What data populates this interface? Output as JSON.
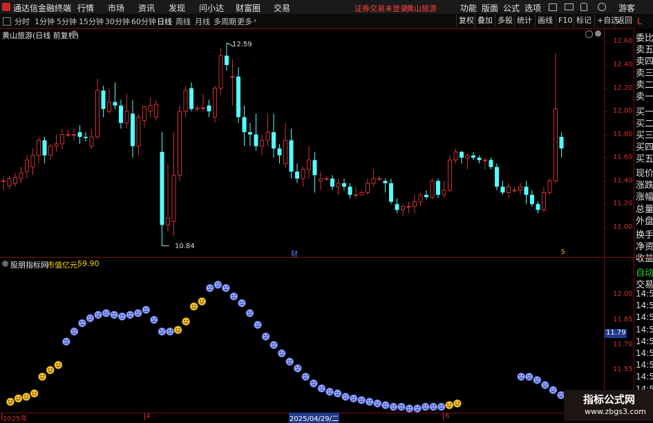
{
  "titlebar": {
    "app_name": "通达信金融终端",
    "menus": [
      "行情",
      "市场",
      "资讯",
      "发现",
      "问小达",
      "财富圈",
      "交易"
    ],
    "login_status": "证券交易未登录",
    "stock_name": "黄山旅游",
    "right_menus": [
      "功能",
      "版面",
      "公式",
      "选项"
    ],
    "user": "游客"
  },
  "toolbar": {
    "periods": [
      "分时",
      "1分钟",
      "5分钟",
      "15分钟",
      "30分钟",
      "60分钟",
      "日线",
      "周线",
      "月线",
      "多周期",
      "更多"
    ],
    "active_period": "日线",
    "right_buttons": [
      "复权",
      "叠加",
      "多股",
      "统计",
      "画线",
      "F10",
      "标记",
      "+自选",
      "返回"
    ]
  },
  "main_chart": {
    "title": "黄山旅游(日线 前复权)",
    "price_ticks": [
      "12.60",
      "12.40",
      "12.20",
      "12.00",
      "11.80",
      "11.60",
      "11.40",
      "11.20",
      "11.00"
    ],
    "high_label": "12.59",
    "low_label": "10.84",
    "marker_cai": "财",
    "marker_s": "S",
    "up_color": "#d23232",
    "down_color": "#54ffff"
  },
  "chart_data": {
    "type": "candlestick",
    "ylim": [
      10.82,
      12.68
    ],
    "candles": [
      {
        "o": 11.4,
        "h": 11.44,
        "l": 11.32,
        "c": 11.4
      },
      {
        "o": 11.36,
        "h": 11.44,
        "l": 11.33,
        "c": 11.42
      },
      {
        "o": 11.38,
        "h": 11.47,
        "l": 11.35,
        "c": 11.43
      },
      {
        "o": 11.42,
        "h": 11.52,
        "l": 11.38,
        "c": 11.47
      },
      {
        "o": 11.48,
        "h": 11.62,
        "l": 11.42,
        "c": 11.58
      },
      {
        "o": 11.52,
        "h": 11.68,
        "l": 11.45,
        "c": 11.62
      },
      {
        "o": 11.62,
        "h": 11.78,
        "l": 11.55,
        "c": 11.75
      },
      {
        "o": 11.75,
        "h": 11.78,
        "l": 11.55,
        "c": 11.62
      },
      {
        "o": 11.62,
        "h": 11.72,
        "l": 11.58,
        "c": 11.7
      },
      {
        "o": 11.7,
        "h": 11.8,
        "l": 11.65,
        "c": 11.72
      },
      {
        "o": 11.72,
        "h": 11.85,
        "l": 11.67,
        "c": 11.8
      },
      {
        "o": 11.8,
        "h": 11.84,
        "l": 11.78,
        "c": 11.8
      },
      {
        "o": 11.8,
        "h": 11.85,
        "l": 11.75,
        "c": 11.8
      },
      {
        "o": 11.82,
        "h": 11.88,
        "l": 11.72,
        "c": 11.78
      },
      {
        "o": 11.78,
        "h": 11.82,
        "l": 11.74,
        "c": 11.77
      },
      {
        "o": 11.7,
        "h": 11.85,
        "l": 11.68,
        "c": 11.78
      },
      {
        "o": 11.78,
        "h": 12.28,
        "l": 11.76,
        "c": 12.18
      },
      {
        "o": 12.18,
        "h": 12.22,
        "l": 11.95,
        "c": 12.02
      },
      {
        "o": 12.0,
        "h": 12.2,
        "l": 11.98,
        "c": 12.08
      },
      {
        "o": 12.08,
        "h": 12.25,
        "l": 12.02,
        "c": 12.05
      },
      {
        "o": 12.05,
        "h": 12.1,
        "l": 11.85,
        "c": 11.9
      },
      {
        "o": 11.9,
        "h": 12.15,
        "l": 11.85,
        "c": 12.0
      },
      {
        "o": 11.98,
        "h": 12.1,
        "l": 11.6,
        "c": 11.7
      },
      {
        "o": 11.7,
        "h": 11.98,
        "l": 11.62,
        "c": 11.95
      },
      {
        "o": 11.92,
        "h": 12.05,
        "l": 11.86,
        "c": 12.04
      },
      {
        "o": 12.0,
        "h": 12.12,
        "l": 11.95,
        "c": 12.05
      },
      {
        "o": 11.95,
        "h": 12.1,
        "l": 11.92,
        "c": 12.06
      },
      {
        "o": 11.65,
        "h": 11.82,
        "l": 10.84,
        "c": 11.02
      },
      {
        "o": 11.02,
        "h": 11.55,
        "l": 10.96,
        "c": 11.08
      },
      {
        "o": 11.05,
        "h": 11.82,
        "l": 10.92,
        "c": 11.45
      },
      {
        "o": 11.45,
        "h": 12.05,
        "l": 11.4,
        "c": 12.0
      },
      {
        "o": 12.0,
        "h": 12.22,
        "l": 11.95,
        "c": 12.18
      },
      {
        "o": 12.2,
        "h": 12.25,
        "l": 12.0,
        "c": 12.02
      },
      {
        "o": 12.02,
        "h": 12.05,
        "l": 12.0,
        "c": 12.03
      },
      {
        "o": 12.03,
        "h": 12.15,
        "l": 12.0,
        "c": 12.03
      },
      {
        "o": 12.05,
        "h": 12.1,
        "l": 11.95,
        "c": 12.0
      },
      {
        "o": 11.95,
        "h": 12.22,
        "l": 11.9,
        "c": 12.2
      },
      {
        "o": 12.2,
        "h": 12.55,
        "l": 12.15,
        "c": 12.48
      },
      {
        "o": 12.48,
        "h": 12.59,
        "l": 12.35,
        "c": 12.4
      },
      {
        "o": 12.3,
        "h": 12.45,
        "l": 12.05,
        "c": 12.3
      },
      {
        "o": 12.3,
        "h": 12.38,
        "l": 11.9,
        "c": 11.95
      },
      {
        "o": 11.95,
        "h": 12.05,
        "l": 11.7,
        "c": 11.82
      },
      {
        "o": 11.82,
        "h": 11.9,
        "l": 11.7,
        "c": 11.8
      },
      {
        "o": 11.8,
        "h": 11.98,
        "l": 11.66,
        "c": 11.7
      },
      {
        "o": 11.7,
        "h": 11.8,
        "l": 11.62,
        "c": 11.75
      },
      {
        "o": 11.75,
        "h": 11.98,
        "l": 11.7,
        "c": 11.82
      },
      {
        "o": 11.82,
        "h": 11.98,
        "l": 11.6,
        "c": 11.68
      },
      {
        "o": 11.68,
        "h": 11.72,
        "l": 11.55,
        "c": 11.62
      },
      {
        "o": 11.55,
        "h": 11.9,
        "l": 11.52,
        "c": 11.75
      },
      {
        "o": 11.75,
        "h": 11.85,
        "l": 11.42,
        "c": 11.48
      },
      {
        "o": 11.48,
        "h": 11.55,
        "l": 11.38,
        "c": 11.42
      },
      {
        "o": 11.42,
        "h": 11.52,
        "l": 11.35,
        "c": 11.5
      },
      {
        "o": 11.5,
        "h": 11.7,
        "l": 11.42,
        "c": 11.58
      },
      {
        "o": 11.58,
        "h": 11.65,
        "l": 11.3,
        "c": 11.45
      },
      {
        "o": 11.4,
        "h": 11.48,
        "l": 11.32,
        "c": 11.42
      },
      {
        "o": 11.42,
        "h": 11.44,
        "l": 11.4,
        "c": 11.42
      },
      {
        "o": 11.42,
        "h": 11.45,
        "l": 11.32,
        "c": 11.35
      },
      {
        "o": 11.35,
        "h": 11.42,
        "l": 11.28,
        "c": 11.38
      },
      {
        "o": 11.38,
        "h": 11.42,
        "l": 11.32,
        "c": 11.35
      },
      {
        "o": 11.35,
        "h": 11.38,
        "l": 11.25,
        "c": 11.28
      },
      {
        "o": 11.28,
        "h": 11.35,
        "l": 11.25,
        "c": 11.28
      },
      {
        "o": 11.28,
        "h": 11.32,
        "l": 11.28,
        "c": 11.3
      },
      {
        "o": 11.3,
        "h": 11.42,
        "l": 11.28,
        "c": 11.38
      },
      {
        "o": 11.38,
        "h": 11.5,
        "l": 11.35,
        "c": 11.42
      },
      {
        "o": 11.42,
        "h": 11.44,
        "l": 11.4,
        "c": 11.42
      },
      {
        "o": 11.4,
        "h": 11.42,
        "l": 11.3,
        "c": 11.38
      },
      {
        "o": 11.38,
        "h": 11.42,
        "l": 11.2,
        "c": 11.22
      },
      {
        "o": 11.2,
        "h": 11.25,
        "l": 11.12,
        "c": 11.15
      },
      {
        "o": 11.15,
        "h": 11.2,
        "l": 11.1,
        "c": 11.18
      },
      {
        "o": 11.18,
        "h": 11.22,
        "l": 11.12,
        "c": 11.18
      },
      {
        "o": 11.18,
        "h": 11.28,
        "l": 11.12,
        "c": 11.22
      },
      {
        "o": 11.22,
        "h": 11.3,
        "l": 11.18,
        "c": 11.28
      },
      {
        "o": 11.28,
        "h": 11.32,
        "l": 11.24,
        "c": 11.26
      },
      {
        "o": 11.26,
        "h": 11.42,
        "l": 11.24,
        "c": 11.4
      },
      {
        "o": 11.4,
        "h": 11.42,
        "l": 11.25,
        "c": 11.28
      },
      {
        "o": 11.28,
        "h": 11.4,
        "l": 11.25,
        "c": 11.32
      },
      {
        "o": 11.32,
        "h": 11.62,
        "l": 11.3,
        "c": 11.58
      },
      {
        "o": 11.58,
        "h": 11.68,
        "l": 11.55,
        "c": 11.65
      },
      {
        "o": 11.65,
        "h": 11.66,
        "l": 11.55,
        "c": 11.6
      },
      {
        "o": 11.6,
        "h": 11.64,
        "l": 11.5,
        "c": 11.62
      },
      {
        "o": 11.62,
        "h": 11.65,
        "l": 11.58,
        "c": 11.6
      },
      {
        "o": 11.6,
        "h": 11.62,
        "l": 11.55,
        "c": 11.58
      },
      {
        "o": 11.58,
        "h": 11.6,
        "l": 11.5,
        "c": 11.58
      },
      {
        "o": 11.58,
        "h": 11.6,
        "l": 11.5,
        "c": 11.52
      },
      {
        "o": 11.52,
        "h": 11.55,
        "l": 11.32,
        "c": 11.35
      },
      {
        "o": 11.35,
        "h": 11.4,
        "l": 11.28,
        "c": 11.3
      },
      {
        "o": 11.3,
        "h": 11.38,
        "l": 11.25,
        "c": 11.35
      },
      {
        "o": 11.32,
        "h": 11.35,
        "l": 11.3,
        "c": 11.32
      },
      {
        "o": 11.32,
        "h": 11.38,
        "l": 11.28,
        "c": 11.35
      },
      {
        "o": 11.35,
        "h": 11.4,
        "l": 11.2,
        "c": 11.28
      },
      {
        "o": 11.28,
        "h": 11.32,
        "l": 11.18,
        "c": 11.2
      },
      {
        "o": 11.2,
        "h": 11.22,
        "l": 11.12,
        "c": 11.15
      },
      {
        "o": 11.15,
        "h": 11.35,
        "l": 11.13,
        "c": 11.3
      },
      {
        "o": 11.3,
        "h": 11.42,
        "l": 11.28,
        "c": 11.4
      },
      {
        "o": 11.4,
        "h": 12.5,
        "l": 11.38,
        "c": 12.02
      },
      {
        "o": 11.78,
        "h": 11.82,
        "l": 11.6,
        "c": 11.68
      }
    ],
    "indicator_ylim": [
      11.32,
      12.13
    ],
    "indicator": [
      {
        "v": 11.36,
        "m": "smile"
      },
      {
        "v": 11.38,
        "m": "smile"
      },
      {
        "v": 11.39,
        "m": "smile"
      },
      {
        "v": 11.41,
        "m": "smile"
      },
      {
        "v": 11.51,
        "m": "smile"
      },
      {
        "v": 11.55,
        "m": "smile"
      },
      {
        "v": 11.58,
        "m": "smile"
      },
      {
        "v": 11.72,
        "m": "frown"
      },
      {
        "v": 11.78,
        "m": "frown"
      },
      {
        "v": 11.83,
        "m": "frown"
      },
      {
        "v": 11.86,
        "m": "frown"
      },
      {
        "v": 11.88,
        "m": "frown"
      },
      {
        "v": 11.89,
        "m": "frown"
      },
      {
        "v": 11.88,
        "m": "frown"
      },
      {
        "v": 11.87,
        "m": "frown"
      },
      {
        "v": 11.88,
        "m": "frown"
      },
      {
        "v": 11.89,
        "m": "frown"
      },
      {
        "v": 11.91,
        "m": "frown"
      },
      {
        "v": 11.85,
        "m": "frown"
      },
      {
        "v": 11.78,
        "m": "frown"
      },
      {
        "v": 11.78,
        "m": "frown"
      },
      {
        "v": 11.79,
        "m": "smile"
      },
      {
        "v": 11.84,
        "m": "smile"
      },
      {
        "v": 11.93,
        "m": "smile"
      },
      {
        "v": 11.96,
        "m": "smile"
      },
      {
        "v": 12.04,
        "m": "frown"
      },
      {
        "v": 12.06,
        "m": "frown"
      },
      {
        "v": 12.04,
        "m": "frown"
      },
      {
        "v": 11.99,
        "m": "frown"
      },
      {
        "v": 11.95,
        "m": "frown"
      },
      {
        "v": 11.89,
        "m": "frown"
      },
      {
        "v": 11.82,
        "m": "frown"
      },
      {
        "v": 11.75,
        "m": "frown"
      },
      {
        "v": 11.7,
        "m": "frown"
      },
      {
        "v": 11.65,
        "m": "frown"
      },
      {
        "v": 11.6,
        "m": "frown"
      },
      {
        "v": 11.56,
        "m": "frown"
      },
      {
        "v": 11.51,
        "m": "frown"
      },
      {
        "v": 11.47,
        "m": "frown"
      },
      {
        "v": 11.44,
        "m": "frown"
      },
      {
        "v": 11.42,
        "m": "frown"
      },
      {
        "v": 11.41,
        "m": "frown"
      },
      {
        "v": 11.39,
        "m": "frown"
      },
      {
        "v": 11.38,
        "m": "frown"
      },
      {
        "v": 11.37,
        "m": "frown"
      },
      {
        "v": 11.36,
        "m": "frown"
      },
      {
        "v": 11.35,
        "m": "frown"
      },
      {
        "v": 11.34,
        "m": "frown"
      },
      {
        "v": 11.33,
        "m": "frown"
      },
      {
        "v": 11.33,
        "m": "frown"
      },
      {
        "v": 11.32,
        "m": "frown"
      },
      {
        "v": 11.32,
        "m": "frown"
      },
      {
        "v": 11.33,
        "m": "frown"
      },
      {
        "v": 11.33,
        "m": "frown"
      },
      {
        "v": 11.33,
        "m": "frown"
      },
      {
        "v": 11.34,
        "m": "smile"
      },
      {
        "v": 11.35,
        "m": "smile"
      },
      {
        "v": null,
        "m": "none"
      },
      {
        "v": null,
        "m": "none"
      },
      {
        "v": null,
        "m": "none"
      },
      {
        "v": null,
        "m": "none"
      },
      {
        "v": null,
        "m": "none"
      },
      {
        "v": null,
        "m": "none"
      },
      {
        "v": null,
        "m": "none"
      },
      {
        "v": 11.51,
        "m": "frown"
      },
      {
        "v": 11.51,
        "m": "frown"
      },
      {
        "v": 11.49,
        "m": "frown"
      },
      {
        "v": 11.46,
        "m": "frown"
      },
      {
        "v": 11.43,
        "m": "frown"
      },
      {
        "v": 11.4,
        "m": "frown"
      },
      {
        "v": 11.38,
        "m": "frown"
      },
      {
        "v": 11.35,
        "m": "smile"
      }
    ]
  },
  "indicator_panel": {
    "name": "股朋指标网",
    "value_label": "市值亿元:",
    "value": "59.90",
    "ticks": [
      "12.00",
      "11.85",
      "11.70",
      "11.55",
      "11.40"
    ],
    "current_value": "11.79"
  },
  "date_axis": {
    "labels": [
      "2025年",
      "4",
      "2025/04/29/二",
      "6"
    ]
  },
  "side_panel": {
    "items": [
      "委比",
      "卖五",
      "卖四",
      "卖三",
      "卖二",
      "卖一",
      "买一",
      "买二",
      "买三",
      "买四",
      "买五",
      "现价",
      "涨跌",
      "涨幅",
      "总量",
      "外盘",
      "换手",
      "净资",
      "收益"
    ],
    "lower_items": [
      "自动",
      "交易"
    ],
    "times": [
      "14:56",
      "14:56",
      "14:56",
      "14:56",
      "14:56",
      "14:56",
      "14:56",
      "14:56",
      "14:56",
      "14:56",
      "14:56"
    ],
    "corner_label": "L"
  },
  "watermark": {
    "line1": "指标公式网",
    "line2": "www.zbgs3.com"
  }
}
